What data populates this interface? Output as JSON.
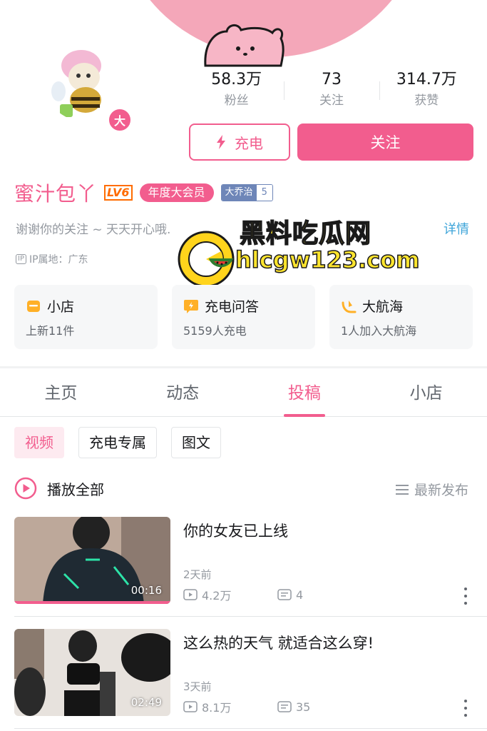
{
  "profile": {
    "level_badge": "大",
    "username": "蜜汁包丫",
    "lv": "LV6",
    "vip": "年度大会员",
    "fan_medal": {
      "name": "大乔治",
      "level": "5"
    },
    "signature": "谢谢你的关注 ~ 天天开心哦.",
    "detail": "详情",
    "ip_tag": "IP",
    "ip_location": "IP属地：广东"
  },
  "stats": [
    {
      "value": "58.3万",
      "label": "粉丝"
    },
    {
      "value": "73",
      "label": "关注"
    },
    {
      "value": "314.7万",
      "label": "获赞"
    }
  ],
  "actions": {
    "charge": "充电",
    "follow": "关注"
  },
  "watermark": {
    "title": "黑料吃瓜网",
    "url": "hlcgw123.com"
  },
  "cards": [
    {
      "title": "小店",
      "sub": "上新11件",
      "icon": "shop-icon",
      "color": "#ffb027"
    },
    {
      "title": "充电问答",
      "sub": "5159人充电",
      "icon": "charge-qa-icon",
      "color": "#ffb027"
    },
    {
      "title": "大航海",
      "sub": "1人加入大航海",
      "icon": "voyage-icon",
      "color": "#ffb027"
    }
  ],
  "tabs": [
    {
      "label": "主页",
      "active": false
    },
    {
      "label": "动态",
      "active": false
    },
    {
      "label": "投稿",
      "active": true
    },
    {
      "label": "小店",
      "active": false
    }
  ],
  "chips": [
    {
      "label": "视频",
      "active": true
    },
    {
      "label": "充电专属",
      "active": false
    },
    {
      "label": "图文",
      "active": false
    }
  ],
  "playall": "播放全部",
  "sort": "最新发布",
  "videos": [
    {
      "title": "你的女友已上线",
      "duration": "00:16",
      "date": "2天前",
      "views": "4.2万",
      "comments": "4",
      "watched_fraction": 1.0
    },
    {
      "title": "这么热的天气 就适合这么穿!",
      "duration": "02:49",
      "date": "3天前",
      "views": "8.1万",
      "comments": "35",
      "watched_fraction": 0.0
    }
  ],
  "colors": {
    "accent": "#f25d8e",
    "banner": "#f4a7b9",
    "link": "#3da4d9"
  }
}
